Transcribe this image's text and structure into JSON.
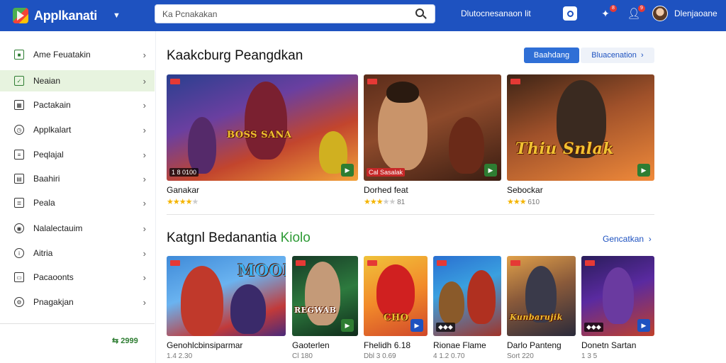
{
  "header": {
    "app_title": "Applkanati",
    "search_placeholder": "Ka Pcnakakan",
    "top_link": "Dlutocnesanaon lit",
    "bell_count": "8",
    "person_count": "9",
    "username": "Dlenjaoane",
    "colors": {
      "bar": "#1e52c0",
      "accent_green": "#2e7d32"
    }
  },
  "sidebar": {
    "items": [
      {
        "label": "Ame Feuatakin",
        "icon": "square-icon"
      },
      {
        "label": "Neaian",
        "icon": "check-square-icon"
      },
      {
        "label": "Pactakain",
        "icon": "calendar-icon"
      },
      {
        "label": "Applkalart",
        "icon": "clock-icon"
      },
      {
        "label": "Peqlajal",
        "icon": "document-icon"
      },
      {
        "label": "Baahiri",
        "icon": "clipboard-icon"
      },
      {
        "label": "Peala",
        "icon": "document-icon"
      },
      {
        "label": "Nalalectauim",
        "icon": "target-icon"
      },
      {
        "label": "Aitria",
        "icon": "info-icon"
      },
      {
        "label": "Pacaoonts",
        "icon": "folder-icon"
      },
      {
        "label": "Pnagakjan",
        "icon": "settings-icon"
      }
    ],
    "footer_value": "2999"
  },
  "section1": {
    "title": "Kaakcburg Peangdkan",
    "primary_button": "Baahdang",
    "secondary_button": "Bluacenation",
    "cards": [
      {
        "name": "Ganakar",
        "price": "1 8 0100",
        "rating": 4,
        "rating_text": "",
        "overlay": "BOSS SANA"
      },
      {
        "name": "Dorhed feat",
        "price": "Cal Sasalak",
        "rating": 3,
        "rating_text": "81",
        "overlay": ""
      },
      {
        "name": "Sebockar",
        "price": "",
        "rating": 3,
        "rating_text": "610",
        "overlay": "Thiu Snlak"
      }
    ]
  },
  "section2": {
    "title": "Katgnl Bedanantia",
    "title_accent": "Kiolo",
    "see_all": "Gencatkan",
    "cards": [
      {
        "name": "Genohlcbinsiparmar",
        "meta": "1.4 2.30",
        "overlay": "MOON"
      },
      {
        "name": "Gaoterlen",
        "meta": "Cl 180",
        "overlay": "REGWAB"
      },
      {
        "name": "Fhelidh 6.18",
        "meta": "Dbl 3 0.69",
        "overlay": "CHO"
      },
      {
        "name": "Rionae Flame",
        "meta": "4 1.2 0.70",
        "overlay": ""
      },
      {
        "name": "Darlo Panteng",
        "meta": "Sort 220",
        "overlay": "Kunbarujik"
      },
      {
        "name": "Donetn Sartan",
        "meta": "1 3 5",
        "overlay": ""
      }
    ]
  }
}
